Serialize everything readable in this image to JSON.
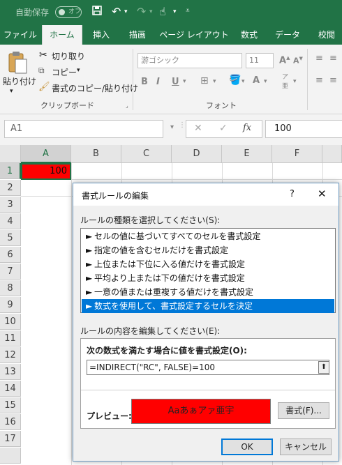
{
  "titlebar": {
    "autosave_label": "自動保存",
    "autosave_state": "オフ",
    "bg_color": "#217346"
  },
  "ribbon_tabs": [
    "ファイル",
    "ホーム",
    "挿入",
    "描画",
    "ページ レイアウト",
    "数式",
    "データ",
    "校閲"
  ],
  "active_tab": "ホーム",
  "clipboard": {
    "paste": "貼り付け",
    "cut": "切り取り",
    "copy": "コピー",
    "format_painter": "書式のコピー/貼り付け",
    "group_label": "クリップボード"
  },
  "font_group": {
    "font_name": "游ゴシック",
    "font_size": "11",
    "bold": "B",
    "italic": "I",
    "underline": "U",
    "group_label": "フォント"
  },
  "formula_bar": {
    "name_box": "A1",
    "fx": "fx",
    "value": "100"
  },
  "grid": {
    "columns": [
      "A",
      "B",
      "C",
      "D",
      "E",
      "F"
    ],
    "rows": [
      "1",
      "2",
      "3",
      "4",
      "5",
      "6",
      "7",
      "8",
      "9",
      "10",
      "11",
      "12",
      "13",
      "14",
      "15",
      "16",
      "17"
    ],
    "cell_a1_value": "100",
    "cell_a1_fill": "#ff0000"
  },
  "dialog": {
    "title": "書式ルールの編集",
    "help": "?",
    "close": "✕",
    "select_rule_type_label": "ルールの種類を選択してください(S):",
    "rule_types": [
      "セルの値に基づいてすべてのセルを書式設定",
      "指定の値を含むセルだけを書式設定",
      "上位または下位に入る値だけを書式設定",
      "平均より上または下の値だけを書式設定",
      "一意の値または重複する値だけを書式設定",
      "数式を使用して、書式設定するセルを決定"
    ],
    "selected_rule_index": 5,
    "edit_rule_label": "ルールの内容を編集してください(E):",
    "formula_label": "次の数式を満たす場合に値を書式設定(O):",
    "formula_value": "=INDIRECT(\"RC\", FALSE)=100",
    "preview_label": "プレビュー:",
    "preview_text": "Aaあぁアァ亜宇",
    "preview_fill": "#ff0000",
    "format_button": "書式(F)...",
    "ok_button": "OK",
    "cancel_button": "キャンセル"
  }
}
